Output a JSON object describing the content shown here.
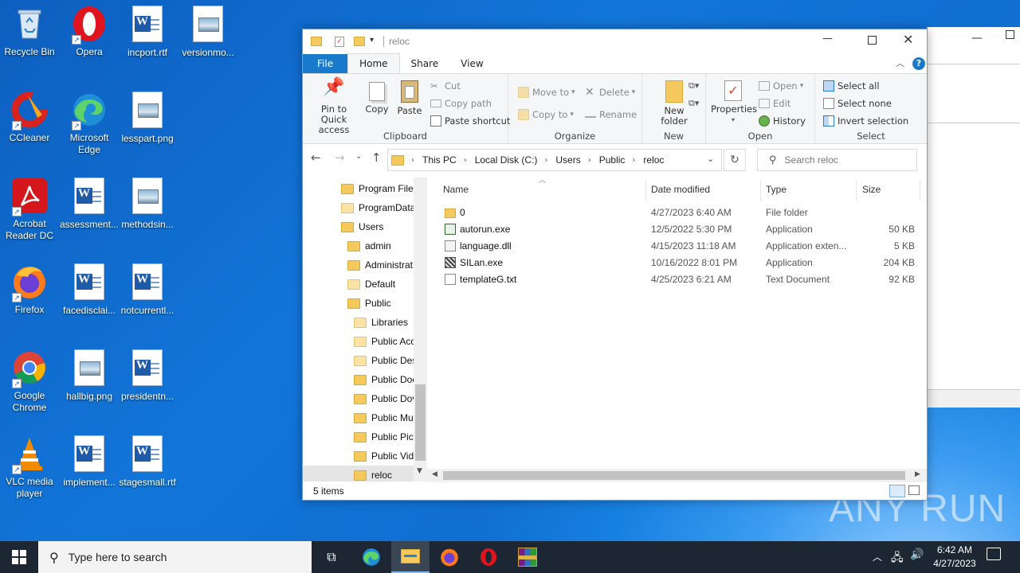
{
  "desktop": {
    "icons": [
      {
        "label": "Recycle Bin"
      },
      {
        "label": "Opera"
      },
      {
        "label": "incport.rtf"
      },
      {
        "label": "versionmo..."
      },
      {
        "label": "CCleaner"
      },
      {
        "label": "Microsoft Edge"
      },
      {
        "label": "lesspart.png"
      },
      {
        "label": "Acrobat Reader DC"
      },
      {
        "label": "assessment..."
      },
      {
        "label": "methodsin..."
      },
      {
        "label": "Firefox"
      },
      {
        "label": "facedisclai..."
      },
      {
        "label": "notcurrentl..."
      },
      {
        "label": "Google Chrome"
      },
      {
        "label": "hallbig.png"
      },
      {
        "label": "presidentn..."
      },
      {
        "label": "VLC media player"
      },
      {
        "label": "implement..."
      },
      {
        "label": "stagesmall.rtf"
      }
    ],
    "watermark": "ANY RUN"
  },
  "explorer": {
    "title": "reloc",
    "tabs": {
      "file": "File",
      "home": "Home",
      "share": "Share",
      "view": "View"
    },
    "ribbon": {
      "clipboard": {
        "pin": "Pin to Quick access",
        "copy": "Copy",
        "paste": "Paste",
        "cut": "Cut",
        "copy_path": "Copy path",
        "paste_shortcut": "Paste shortcut",
        "name": "Clipboard"
      },
      "organize": {
        "move_to": "Move to",
        "copy_to": "Copy to",
        "delete": "Delete",
        "rename": "Rename",
        "name": "Organize"
      },
      "new": {
        "new_folder": "New folder",
        "name": "New"
      },
      "open": {
        "properties": "Properties",
        "open": "Open",
        "edit": "Edit",
        "history": "History",
        "name": "Open"
      },
      "select": {
        "select_all": "Select all",
        "select_none": "Select none",
        "invert": "Invert selection",
        "name": "Select"
      }
    },
    "breadcrumb": [
      "This PC",
      "Local Disk (C:)",
      "Users",
      "Public",
      "reloc"
    ],
    "search_placeholder": "Search reloc",
    "nav_tree": [
      {
        "label": "Program Files",
        "light": false
      },
      {
        "label": "ProgramData",
        "light": true
      },
      {
        "label": "Users",
        "light": false
      },
      {
        "label": "admin",
        "light": false
      },
      {
        "label": "Administrat",
        "light": false
      },
      {
        "label": "Default",
        "light": true
      },
      {
        "label": "Public",
        "light": false
      },
      {
        "label": "Libraries",
        "light": true
      },
      {
        "label": "Public Acc",
        "light": true
      },
      {
        "label": "Public Des",
        "light": true
      },
      {
        "label": "Public Doc",
        "light": false
      },
      {
        "label": "Public Dov",
        "light": false
      },
      {
        "label": "Public Mu",
        "light": false
      },
      {
        "label": "Public Pict",
        "light": false
      },
      {
        "label": "Public Vid",
        "light": false
      },
      {
        "label": "reloc",
        "light": false
      }
    ],
    "columns": {
      "name": "Name",
      "date": "Date modified",
      "type": "Type",
      "size": "Size"
    },
    "files": [
      {
        "name": "0",
        "date": "4/27/2023 6:40 AM",
        "type": "File folder",
        "size": "",
        "icon": "folder-icon"
      },
      {
        "name": "autorun.exe",
        "date": "12/5/2022 5:30 PM",
        "type": "Application",
        "size": "50 KB",
        "icon": "app-icon"
      },
      {
        "name": "language.dll",
        "date": "4/15/2023 11:18 AM",
        "type": "Application exten...",
        "size": "5 KB",
        "icon": "dll-icon"
      },
      {
        "name": "SILan.exe",
        "date": "10/16/2022 8:01 PM",
        "type": "Application",
        "size": "204 KB",
        "icon": "exe-icon"
      },
      {
        "name": "templateG.txt",
        "date": "4/25/2023 6:21 AM",
        "type": "Text Document",
        "size": "92 KB",
        "icon": "text-file-icon"
      }
    ],
    "status": "5 items"
  },
  "taskbar": {
    "search_placeholder": "Type here to search",
    "time": "6:42 AM",
    "date": "4/27/2023"
  }
}
